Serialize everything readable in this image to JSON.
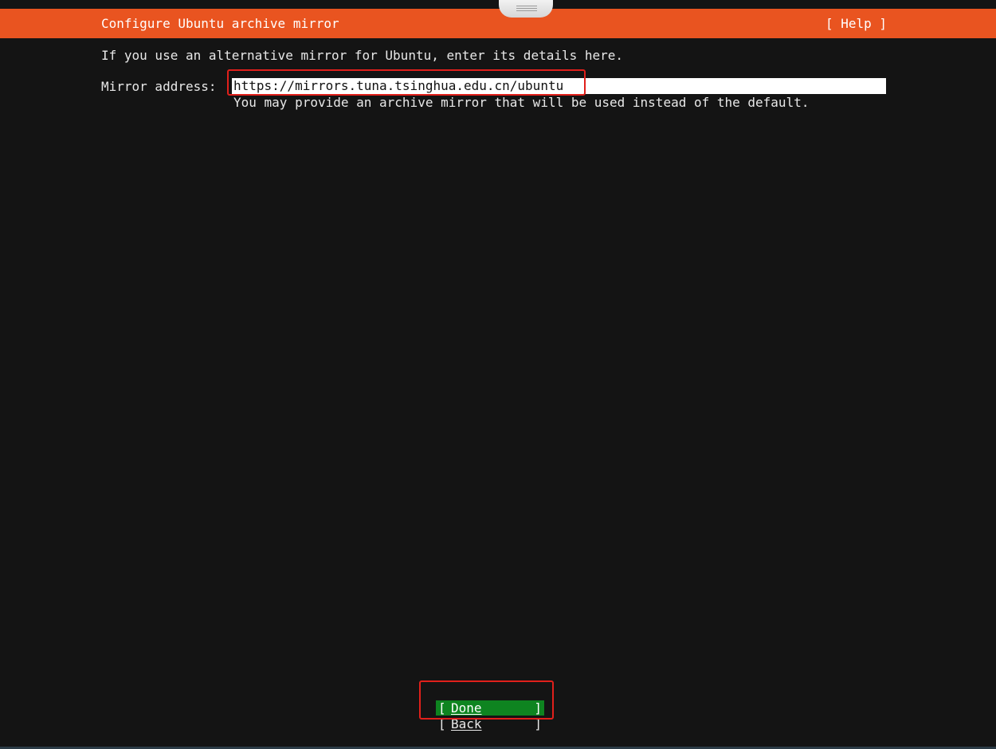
{
  "header": {
    "title": "Configure Ubuntu archive mirror",
    "help_label": "[ Help ]"
  },
  "intro": "If you use an alternative mirror for Ubuntu, enter its details here.",
  "mirror": {
    "label": "Mirror address:",
    "value": "https://mirrors.tuna.tsinghua.edu.cn/ubuntu",
    "help": "You may provide an archive mirror that will be used instead of the default."
  },
  "buttons": {
    "done": "Done",
    "back": "Back",
    "bracket_left": "[",
    "bracket_right": "]"
  },
  "colors": {
    "header_bg": "#e95420",
    "focused_button_bg": "#0e8420",
    "background": "#141414",
    "annotation": "#e0201b"
  }
}
